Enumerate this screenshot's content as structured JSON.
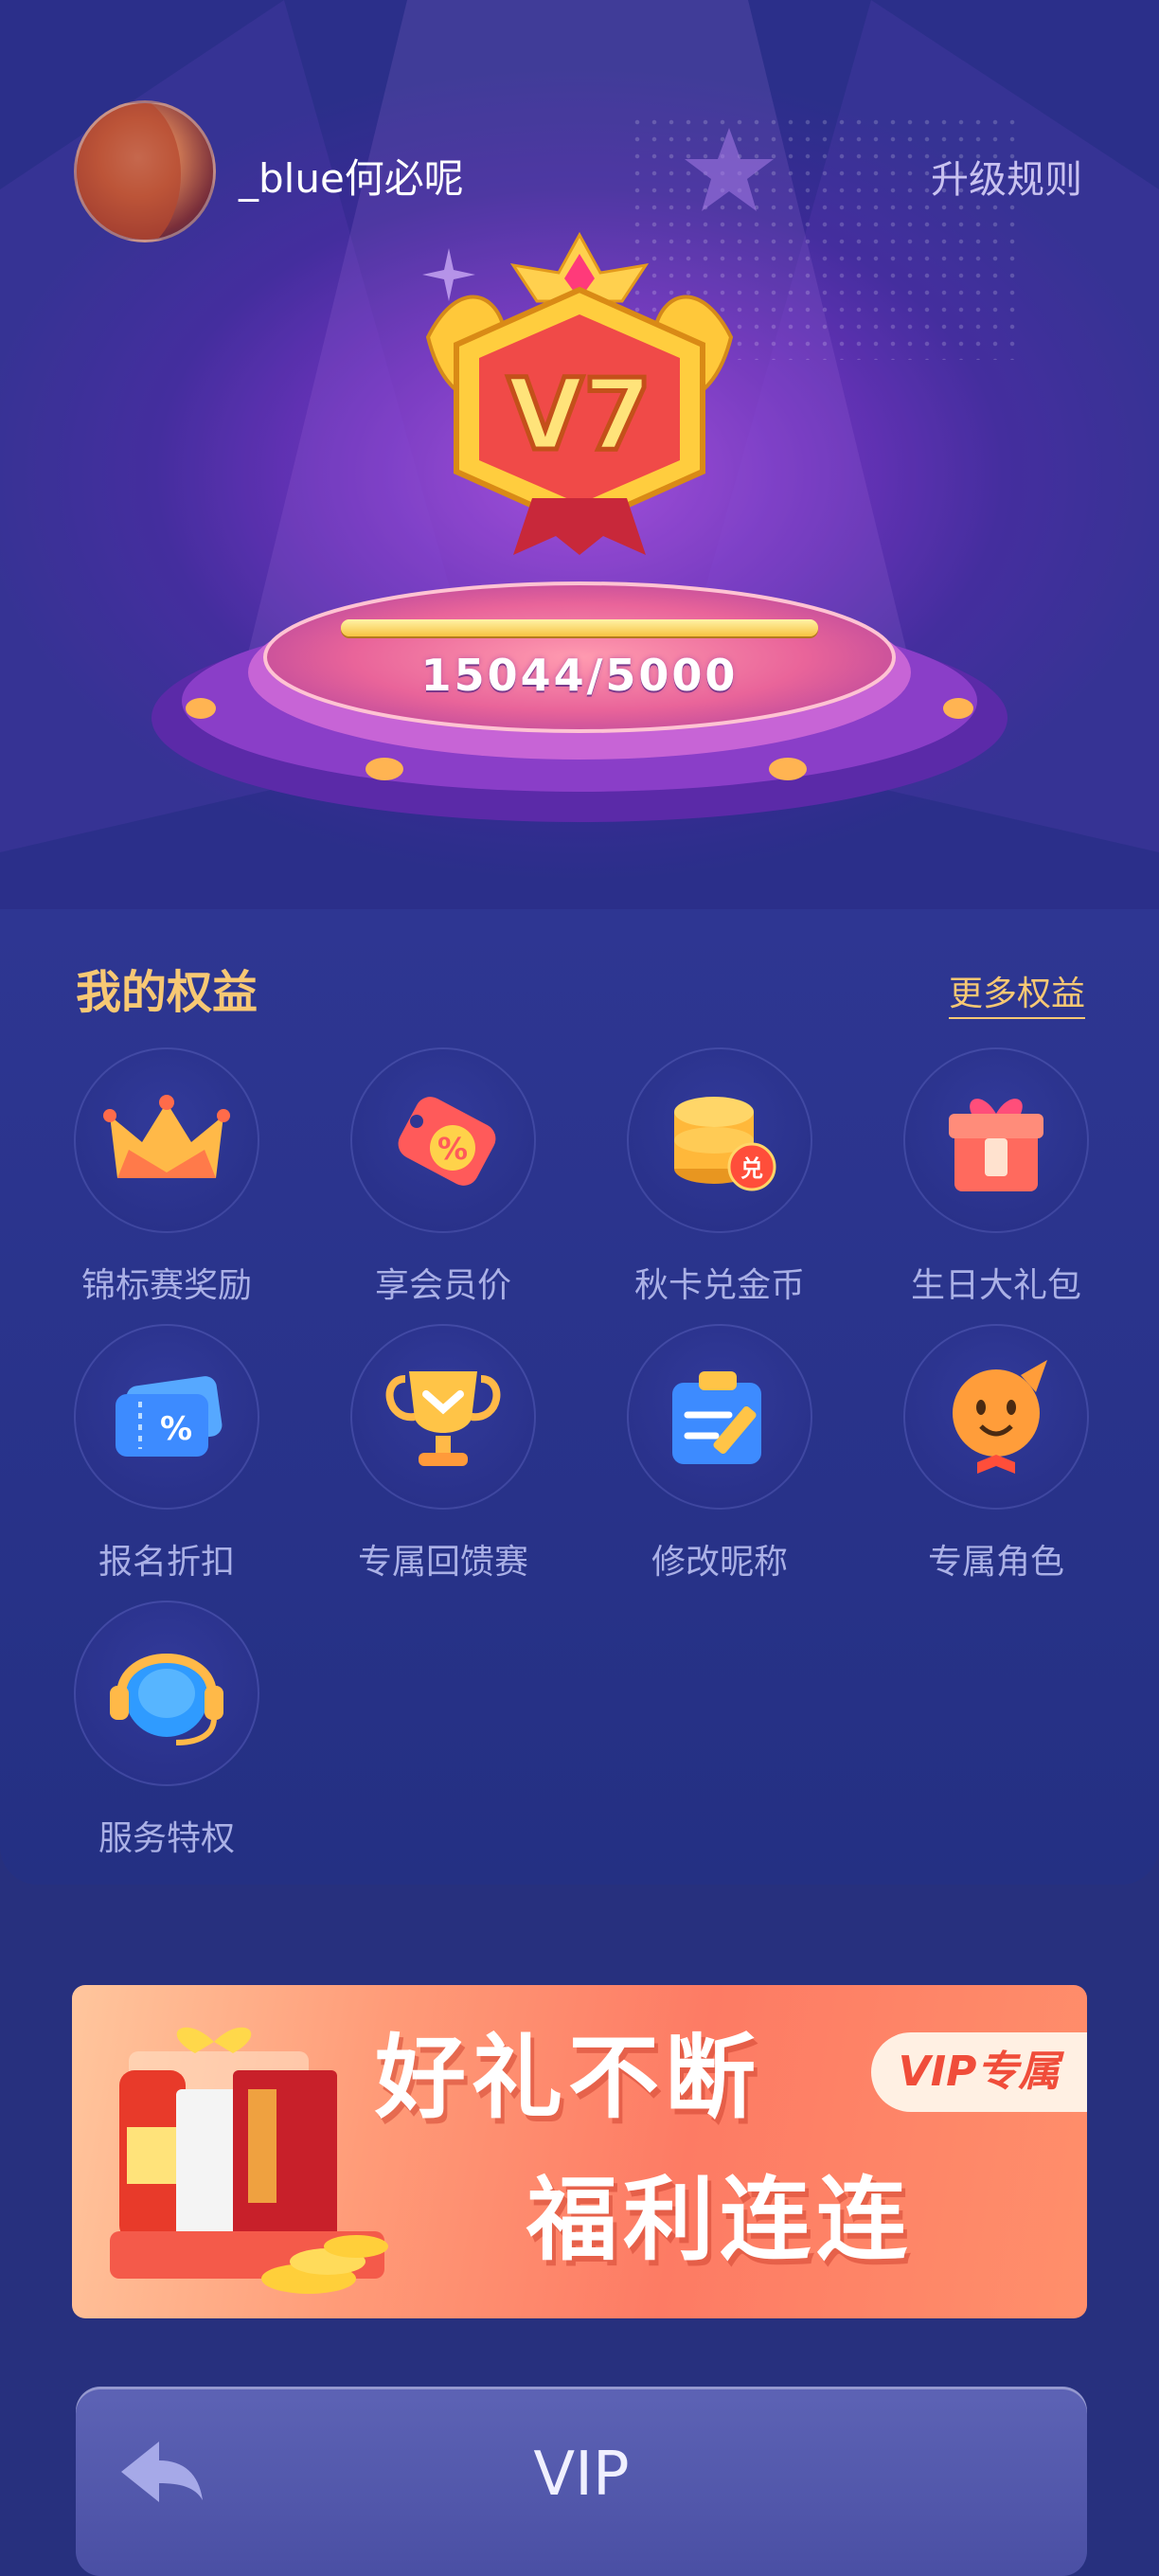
{
  "header": {
    "username": "_blue何必呢",
    "rules_link": "升级规则"
  },
  "level": {
    "badge_text": "V7",
    "progress_text": "15044/5000",
    "progress_fraction": 1.0
  },
  "benefits": {
    "title": "我的权益",
    "more_link": "更多权益",
    "items": [
      {
        "label": "锦标赛奖励",
        "icon": "crown-icon"
      },
      {
        "label": "享会员价",
        "icon": "discount-tag-icon"
      },
      {
        "label": "秋卡兑金币",
        "icon": "coin-exchange-icon"
      },
      {
        "label": "生日大礼包",
        "icon": "gift-box-icon"
      },
      {
        "label": "报名折扣",
        "icon": "discount-ticket-icon"
      },
      {
        "label": "专属回馈赛",
        "icon": "trophy-icon"
      },
      {
        "label": "修改昵称",
        "icon": "edit-note-icon"
      },
      {
        "label": "专属角色",
        "icon": "character-icon"
      },
      {
        "label": "服务特权",
        "icon": "headset-icon"
      }
    ]
  },
  "banner": {
    "line1": "好礼不断",
    "line2": "福利连连",
    "tag": "VIP专属"
  },
  "bottom_bar": {
    "title": "VIP"
  },
  "colors": {
    "accent_gold": "#f7c874",
    "panel_bg": "#2e3692"
  }
}
